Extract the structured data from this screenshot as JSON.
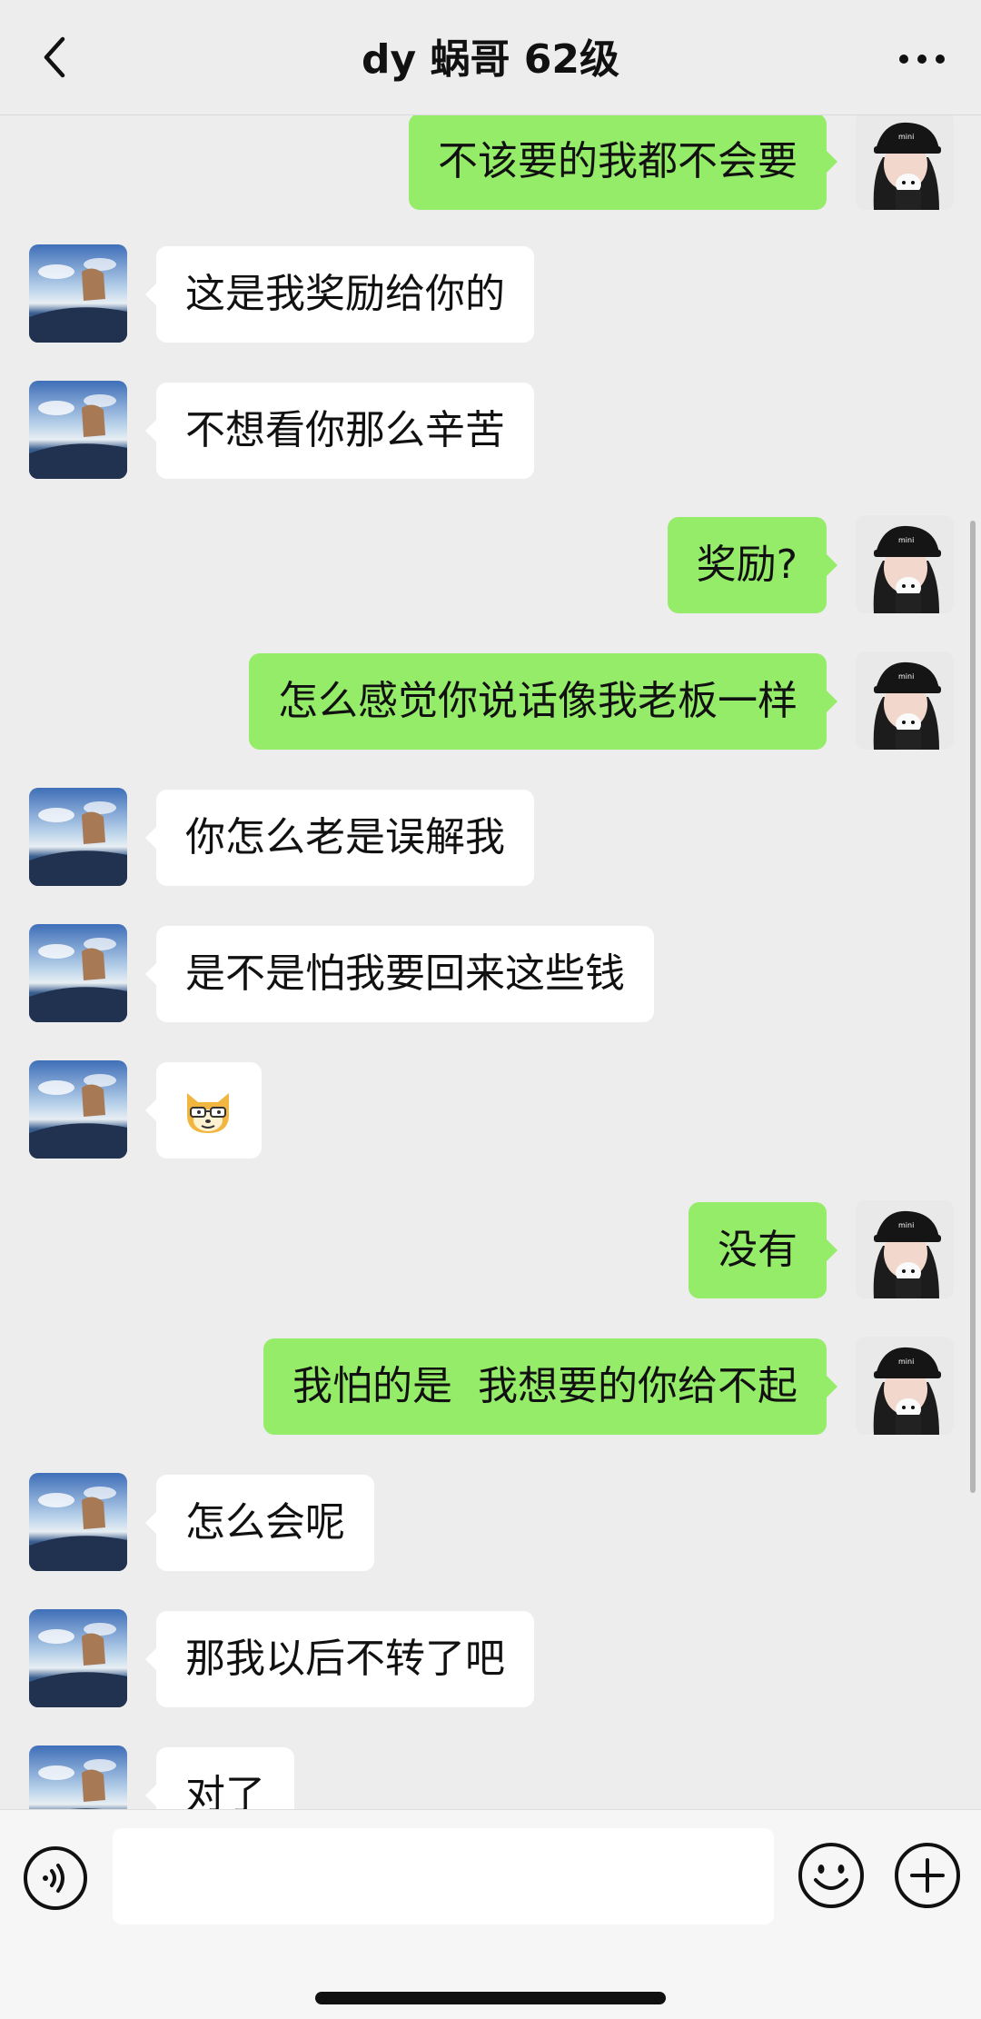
{
  "header": {
    "title": "dy 蜗哥 62级",
    "back_icon": "chevron-left-icon",
    "more_icon": "more-dots-icon"
  },
  "messages": [
    {
      "side": "right",
      "text": "不该要的我都不会要"
    },
    {
      "side": "left",
      "text": "这是我奖励给你的"
    },
    {
      "side": "left",
      "text": "不想看你那么辛苦"
    },
    {
      "side": "right",
      "text": "奖励?"
    },
    {
      "side": "right",
      "text": "怎么感觉你说话像我老板一样"
    },
    {
      "side": "left",
      "text": "你怎么老是误解我"
    },
    {
      "side": "left",
      "text": "是不是怕我要回来这些钱"
    },
    {
      "side": "left",
      "text": "",
      "emoji": "doge-emoji-icon"
    },
    {
      "side": "right",
      "text": "没有"
    },
    {
      "side": "right",
      "text": "我怕的是  我想要的你给不起"
    },
    {
      "side": "left",
      "text": "怎么会呢"
    },
    {
      "side": "left",
      "text": "那我以后不转了吧"
    },
    {
      "side": "left",
      "text": "对了"
    }
  ],
  "input_bar": {
    "voice_icon": "voice-icon",
    "text_value": "",
    "emoji_icon": "emoji-smile-icon",
    "plus_icon": "plus-circle-icon"
  },
  "colors": {
    "background": "#ededed",
    "bubble_self": "#95ec69",
    "bubble_other": "#ffffff"
  }
}
